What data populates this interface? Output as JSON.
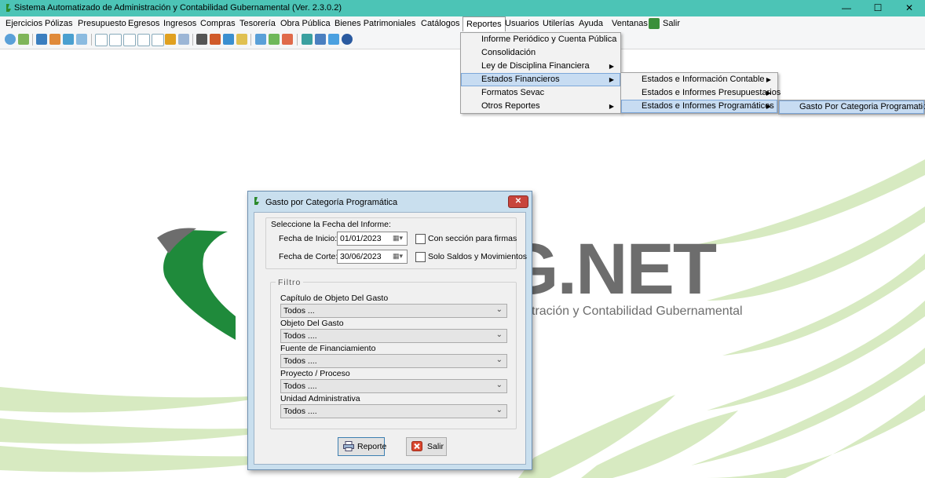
{
  "window": {
    "title": "Sistema Automatizado de Administración y Contabilidad Gubernamental  (Ver. 2.3.0.2)",
    "minimize": "—",
    "maximize": "☐",
    "close": "✕"
  },
  "menubar": {
    "items": [
      "Ejercicios",
      "Pólizas",
      "Presupuesto",
      "Egresos",
      "Ingresos",
      "Compras",
      "Tesorería",
      "Obra Pública",
      "Bienes Patrimoniales",
      "Catálogos",
      "Reportes",
      "Usuarios",
      "Utilerías",
      "Ayuda",
      "Ventanas",
      "Salir"
    ]
  },
  "reportes_menu": {
    "items": [
      "Informe Periódico y Cuenta Pública",
      "Consolidación",
      "Ley de Disciplina Financiera",
      "Estados Financieros",
      "Formatos Sevac",
      "Otros Reportes"
    ]
  },
  "estados_menu": {
    "items": [
      "Estados e Información Contable",
      "Estados e Informes Presupuestarios",
      "Estados e Informes Programáticos"
    ]
  },
  "programaticos_menu": {
    "items": [
      "Gasto Por Categoria Programatica"
    ]
  },
  "background": {
    "logo_text": "G.NET",
    "logo_subtitle": "tración y Contabilidad Gubernamental",
    "colors": {
      "green": "#1f8a3b",
      "gray": "#6d6d6d",
      "swoosh": "#d7eac1"
    }
  },
  "dialog": {
    "title": "Gasto por Categoría Programática",
    "close": "✕",
    "fecha_group": "Seleccione la Fecha del Informe:",
    "fecha_inicio_label": "Fecha de Inicio:",
    "fecha_inicio": "01/01/2023",
    "fecha_corte_label": "Fecha de Corte:",
    "fecha_corte": "30/06/2023",
    "chk_firmas": "Con sección para firmas",
    "chk_saldos": "Solo Saldos y Movimientos",
    "filtro_group": "Filtro",
    "filters": [
      {
        "label": "Capítulo de Objeto Del Gasto",
        "value": "Todos  ..."
      },
      {
        "label": "Objeto Del Gasto",
        "value": "Todos ...."
      },
      {
        "label": "Fuente de Financiamiento",
        "value": "Todos ...."
      },
      {
        "label": "Proyecto / Proceso",
        "value": "Todos ...."
      },
      {
        "label": "Unidad Administrativa",
        "value": "Todos ...."
      }
    ],
    "btn_reporte": "Reporte",
    "btn_salir": "Salir"
  }
}
